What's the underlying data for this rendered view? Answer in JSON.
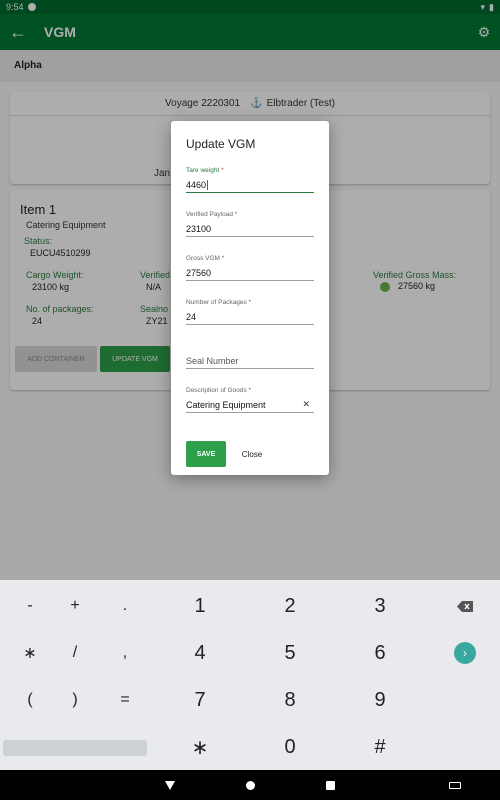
{
  "status_bar": {
    "time": "9:54"
  },
  "app_bar": {
    "title": "VGM"
  },
  "sub_bar": {
    "label": "Alpha"
  },
  "voyage": {
    "number": "Voyage 2220301",
    "vessel": "Elbtrader (Test)",
    "date_fragment": "Jan"
  },
  "item": {
    "title": "Item 1",
    "subtitle": "Catering Equipment",
    "status_label": "Status:",
    "container": "EUCU4510299",
    "cargo_weight_label": "Cargo Weight:",
    "cargo_weight_value": "23100 kg",
    "verified_label_fragment": "Verified",
    "verified_value": "N/A",
    "vgm_label": "Verified Gross Mass:",
    "vgm_value": "27560 kg",
    "packages_label": "No. of packages:",
    "packages_value": "24",
    "sealno_label_fragment": "Sealno",
    "sealno_value_fragment": "ZY21",
    "add_container_label": "ADD CONTAINER",
    "update_vgm_label": "UPDATE VGM"
  },
  "dialog": {
    "title": "Update VGM",
    "fields": [
      {
        "label": "Tare weight",
        "required": "*",
        "value": "4460"
      },
      {
        "label": "Verified Payload",
        "required": "*",
        "value": "23100"
      },
      {
        "label": "Gross VGM",
        "required": "*",
        "value": "27560"
      },
      {
        "label": "Number of Packages",
        "required": "*",
        "value": "24"
      },
      {
        "placeholder": "Seal Number"
      },
      {
        "label": "Description of Goods",
        "required": "*",
        "value": "Catering Equipment",
        "clear_glyph": "✕"
      }
    ],
    "save_label": "SAVE",
    "close_label": "Close"
  },
  "keyboard": {
    "row1": [
      "-",
      "+",
      ".",
      "1",
      "2",
      "3"
    ],
    "row2": [
      "∗",
      "/",
      ",",
      "4",
      "5",
      "6"
    ],
    "row3": [
      "(",
      ")",
      "=",
      "7",
      "8",
      "9"
    ],
    "row4": [
      "∗",
      "0",
      "#"
    ],
    "backspace_icon": "backspace-icon",
    "enter_icon": "enter-icon"
  },
  "colors": {
    "primary": "#007a34",
    "accent": "#2ea04a",
    "status_dot": "#69b64d"
  }
}
